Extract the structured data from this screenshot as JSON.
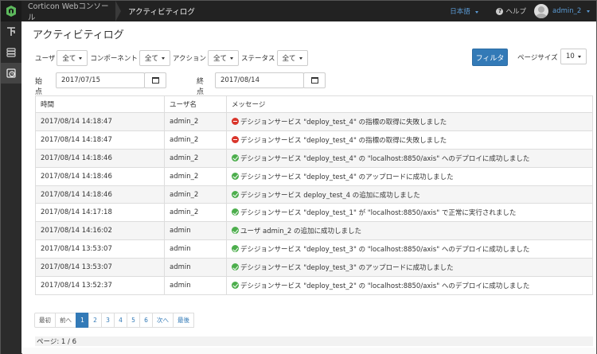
{
  "header": {
    "brand": "Corticon Webコンソール",
    "breadcrumb": "アクティビティログ",
    "language": "日本語",
    "help": "ヘルプ",
    "user": "admin_2"
  },
  "sidebar": {
    "items": [
      {
        "icon": "rules-icon"
      },
      {
        "icon": "database-icon"
      },
      {
        "icon": "activity-log-icon"
      }
    ]
  },
  "page": {
    "title": "アクティビティログ"
  },
  "filters": {
    "user_label": "ユーザ",
    "user_value": "全て",
    "component_label": "コンポーネント",
    "component_value": "全て",
    "action_label": "アクション",
    "action_value": "全て",
    "status_label": "ステータス",
    "status_value": "全て",
    "filter_button": "フィルタ",
    "page_size_label": "ページサイズ",
    "page_size_value": "10",
    "start_label": "始点",
    "start_date": "2017/07/15",
    "end_label": "終点",
    "end_date": "2017/08/14"
  },
  "table": {
    "headers": [
      "時間",
      "ユーザ名",
      "メッセージ"
    ],
    "rows": [
      {
        "time": "2017/08/14 14:18:47",
        "user": "admin_2",
        "status": "error",
        "message": "デシジョンサービス \"deploy_test_4\" の指標の取得に失敗しました"
      },
      {
        "time": "2017/08/14 14:18:47",
        "user": "admin_2",
        "status": "error",
        "message": "デシジョンサービス \"deploy_test_4\" の指標の取得に失敗しました"
      },
      {
        "time": "2017/08/14 14:18:46",
        "user": "admin_2",
        "status": "success",
        "message": "デシジョンサービス \"deploy_test_4\" の \"localhost:8850/axis\" へのデプロイに成功しました"
      },
      {
        "time": "2017/08/14 14:18:46",
        "user": "admin_2",
        "status": "success",
        "message": "デシジョンサービス \"deploy_test_4\" のアップロードに成功しました"
      },
      {
        "time": "2017/08/14 14:18:46",
        "user": "admin_2",
        "status": "success",
        "message": "デシジョンサービス deploy_test_4 の追加に成功しました"
      },
      {
        "time": "2017/08/14 14:17:18",
        "user": "admin_2",
        "status": "success",
        "message": "デシジョンサービス \"deploy_test_1\" が \"localhost:8850/axis\" で正常に実行されました"
      },
      {
        "time": "2017/08/14 14:16:02",
        "user": "admin",
        "status": "success",
        "message": "ユーザ admin_2 の追加に成功しました"
      },
      {
        "time": "2017/08/14 13:53:07",
        "user": "admin",
        "status": "success",
        "message": "デシジョンサービス \"deploy_test_3\" の \"localhost:8850/axis\" へのデプロイに成功しました"
      },
      {
        "time": "2017/08/14 13:53:07",
        "user": "admin",
        "status": "success",
        "message": "デシジョンサービス \"deploy_test_3\" のアップロードに成功しました"
      },
      {
        "time": "2017/08/14 13:52:37",
        "user": "admin",
        "status": "success",
        "message": "デシジョンサービス \"deploy_test_2\" の \"localhost:8850/axis\" へのデプロイに成功しました"
      }
    ]
  },
  "pagination": {
    "first": "最初",
    "prev": "前へ",
    "pages": [
      "1",
      "2",
      "3",
      "4",
      "5",
      "6"
    ],
    "active": "1",
    "next": "次へ",
    "last": "最後",
    "page_info": "ページ: 1 / 6"
  },
  "colors": {
    "primary": "#337ab7",
    "error": "#d9352b",
    "success": "#4cae4c",
    "topbar": "#222222",
    "logo_green": "#5cb85c"
  }
}
